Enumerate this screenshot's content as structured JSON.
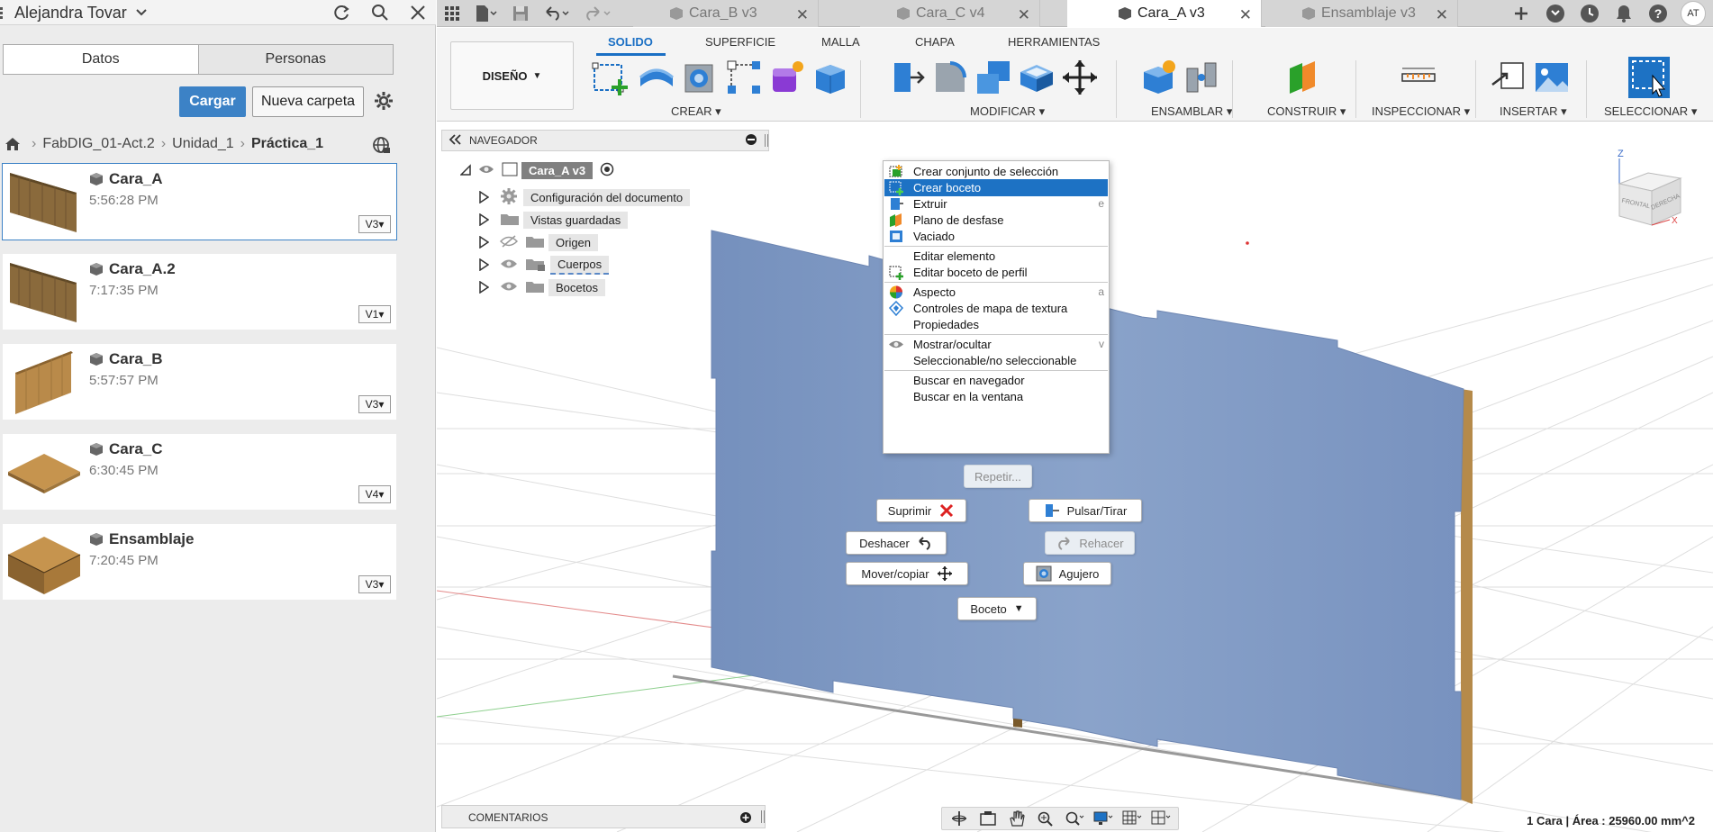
{
  "left_panel": {
    "user_name": "Alejandra Tovar",
    "tabs": [
      "Datos",
      "Personas"
    ],
    "upload_label": "Cargar",
    "new_folder_label": "Nueva carpeta",
    "breadcrumb": [
      "FabDIG_01-Act.2",
      "Unidad_1",
      "Práctica_1"
    ],
    "files": [
      {
        "name": "Cara_A",
        "time": "5:56:28 PM",
        "version": "V3",
        "thumb": "tilted-board"
      },
      {
        "name": "Cara_A.2",
        "time": "7:17:35 PM",
        "version": "V1",
        "thumb": "tilted-board"
      },
      {
        "name": "Cara_B",
        "time": "5:57:57 PM",
        "version": "V3",
        "thumb": "tilted-board-2"
      },
      {
        "name": "Cara_C",
        "time": "6:30:45 PM",
        "version": "V4",
        "thumb": "flat-board"
      },
      {
        "name": "Ensamblaje",
        "time": "7:20:45 PM",
        "version": "V3",
        "thumb": "box"
      }
    ]
  },
  "tabbar": {
    "tabs": [
      {
        "label": "Cara_B v3",
        "active": false
      },
      {
        "label": "Cara_C v4",
        "active": false
      },
      {
        "label": "Cara_A v3",
        "active": true
      },
      {
        "label": "Ensamblaje v3",
        "active": false
      }
    ],
    "avatar_initials": "AT"
  },
  "toolbar": {
    "workspace": "DISEÑO",
    "tabs": [
      "SOLIDO",
      "SUPERFICIE",
      "MALLA",
      "CHAPA",
      "HERRAMIENTAS"
    ],
    "groups": [
      "CREAR",
      "MODIFICAR",
      "ENSAMBLAR",
      "CONSTRUIR",
      "INSPECCIONAR",
      "INSERTAR",
      "SELECCIONAR"
    ]
  },
  "navigator": {
    "title": "NAVEGADOR",
    "root": "Cara_A v3",
    "items": [
      "Configuración del documento",
      "Vistas guardadas",
      "Origen",
      "Cuerpos",
      "Bocetos"
    ]
  },
  "context_menu": {
    "items": [
      {
        "label": "Crear conjunto de selección",
        "shortcut": ""
      },
      {
        "label": "Crear boceto",
        "shortcut": ""
      },
      {
        "label": "Extruir",
        "shortcut": "e"
      },
      {
        "label": "Plano de desfase",
        "shortcut": ""
      },
      {
        "label": "Vaciado",
        "shortcut": ""
      },
      {
        "label": "Editar elemento",
        "shortcut": ""
      },
      {
        "label": "Editar boceto de perfil",
        "shortcut": ""
      },
      {
        "label": "Aspecto",
        "shortcut": "a"
      },
      {
        "label": "Controles de mapa de textura",
        "shortcut": ""
      },
      {
        "label": "Propiedades",
        "shortcut": ""
      },
      {
        "label": "Mostrar/ocultar",
        "shortcut": "v"
      },
      {
        "label": "Seleccionable/no seleccionable",
        "shortcut": ""
      },
      {
        "label": "Buscar en navegador",
        "shortcut": ""
      },
      {
        "label": "Buscar en la ventana",
        "shortcut": ""
      }
    ]
  },
  "marking_menu": {
    "repeat": "Repetir...",
    "suppress": "Suprimir",
    "press_pull": "Pulsar/Tirar",
    "undo": "Deshacer",
    "redo": "Rehacer",
    "move_copy": "Mover/copiar",
    "hole": "Agujero",
    "sketch": "Boceto"
  },
  "viewcube": {
    "front": "FRONTAL",
    "right": "DERECHA",
    "axis_z": "Z",
    "axis_x": "X"
  },
  "comments": {
    "title": "COMENTARIOS"
  },
  "status": {
    "text": "1 Cara | Área : 25960.00 mm^2"
  },
  "colors": {
    "accent": "#1d72c4",
    "panel_face": "#7f9bc6",
    "panel_edge": "#b58a4a"
  }
}
